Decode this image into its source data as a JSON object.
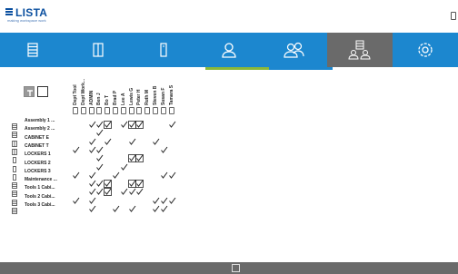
{
  "brand": {
    "name": "LISTA",
    "tagline": "making workspace work"
  },
  "nav": {
    "items": [
      {
        "icon": "drawer-cabinet-icon"
      },
      {
        "icon": "cabinet-icon"
      },
      {
        "icon": "locker-icon"
      },
      {
        "icon": "user-icon"
      },
      {
        "icon": "group-icon"
      },
      {
        "icon": "user-cabinet-assign-icon"
      },
      {
        "icon": "settings-icon"
      }
    ],
    "active_index": 5,
    "accent_colors": {
      "nav": "#1c87cf",
      "active": "#6a6a6a",
      "under_green": "#8ab83a",
      "under_blue": "#1c87cf"
    }
  },
  "matrix": {
    "columns": [
      "Dept Tool",
      "Dept Work...",
      "ADMIN",
      "Ben J",
      "Bo T",
      "Brad P",
      "Lee A",
      "Lewis G",
      "Peter H",
      "Ruth M",
      "Steven B",
      "Susan F",
      "Tamara S"
    ],
    "rows": [
      {
        "label": "Assembly 1 ...",
        "icon": "drawer-cabinet-icon",
        "checks": [
          0,
          0,
          1,
          1,
          1,
          0,
          1,
          1,
          1,
          0,
          0,
          0,
          1
        ]
      },
      {
        "label": "Assembly 2 ...",
        "icon": "drawer-cabinet-icon",
        "checks": [
          0,
          0,
          0,
          1,
          0,
          0,
          0,
          0,
          0,
          0,
          0,
          0,
          0
        ]
      },
      {
        "label": "CABINET E",
        "icon": "cabinet-icon",
        "checks": [
          0,
          0,
          1,
          0,
          1,
          0,
          0,
          1,
          0,
          0,
          1,
          0,
          0
        ]
      },
      {
        "label": "CABINET T",
        "icon": "cabinet-icon",
        "checks": [
          1,
          0,
          1,
          1,
          0,
          0,
          0,
          0,
          0,
          0,
          0,
          1,
          0
        ]
      },
      {
        "label": "LOCKERS 1",
        "icon": "locker-icon",
        "checks": [
          0,
          0,
          0,
          1,
          0,
          0,
          0,
          1,
          1,
          0,
          0,
          0,
          0
        ]
      },
      {
        "label": "LOCKERS 2",
        "icon": "locker-icon",
        "checks": [
          0,
          0,
          0,
          1,
          0,
          0,
          1,
          0,
          0,
          0,
          0,
          0,
          0
        ]
      },
      {
        "label": "LOCKERS 3",
        "icon": "locker-icon",
        "checks": [
          1,
          0,
          1,
          0,
          0,
          1,
          0,
          0,
          0,
          0,
          0,
          1,
          1
        ]
      },
      {
        "label": "Maintenance ...",
        "icon": "drawer-cabinet-icon",
        "checks": [
          0,
          0,
          1,
          1,
          1,
          0,
          0,
          1,
          1,
          0,
          0,
          0,
          0
        ]
      },
      {
        "label": "Tools 1 Cabi...",
        "icon": "drawer-cabinet-icon",
        "checks": [
          0,
          0,
          1,
          1,
          1,
          0,
          1,
          1,
          1,
          0,
          0,
          0,
          0
        ]
      },
      {
        "label": "Tools 2 Cabi...",
        "icon": "drawer-cabinet-icon",
        "checks": [
          1,
          0,
          1,
          0,
          0,
          0,
          0,
          0,
          0,
          0,
          1,
          1,
          1
        ]
      },
      {
        "label": "Tools 3 Cabi...",
        "icon": "drawer-cabinet-icon",
        "checks": [
          0,
          0,
          1,
          0,
          0,
          1,
          0,
          1,
          0,
          0,
          1,
          1,
          0
        ]
      }
    ],
    "boxed": [
      {
        "row": 0,
        "col": 4
      },
      {
        "row": 0,
        "col": 7
      },
      {
        "row": 0,
        "col": 8
      },
      {
        "row": 4,
        "col": 7
      },
      {
        "row": 4,
        "col": 8
      },
      {
        "row": 7,
        "col": 4
      },
      {
        "row": 7,
        "col": 7
      },
      {
        "row": 7,
        "col": 8
      },
      {
        "row": 8,
        "col": 4
      }
    ]
  },
  "toolbar": {
    "toggle_icon": "view-toggle-icon",
    "checkbox_icon": "select-all-checkbox-icon"
  },
  "footer": {
    "icon": "save-icon"
  }
}
